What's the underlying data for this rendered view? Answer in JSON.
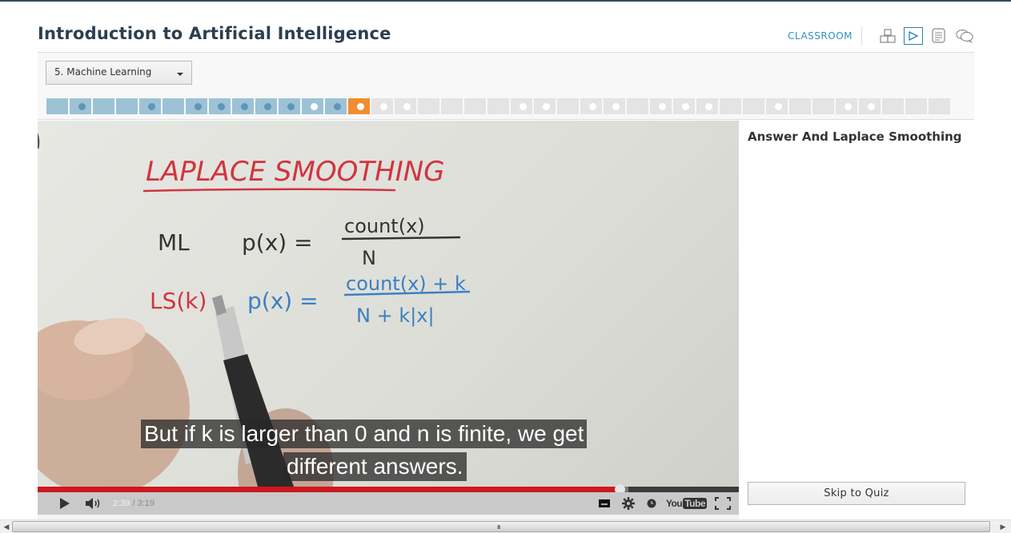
{
  "header": {
    "title": "Introduction to Artificial Intelligence",
    "classroom_link": "CLASSROOM",
    "nav_icons": [
      "course-map-icon",
      "video-icon",
      "notes-icon",
      "discussion-icon"
    ],
    "active_icon": "video-icon"
  },
  "lesson_selector": {
    "selected": "5. Machine Learning"
  },
  "progress": {
    "segments": [
      {
        "state": "done",
        "dot": "none"
      },
      {
        "state": "done",
        "dot": "blue"
      },
      {
        "state": "done",
        "dot": "none"
      },
      {
        "state": "done",
        "dot": "none"
      },
      {
        "state": "done",
        "dot": "blue"
      },
      {
        "state": "done",
        "dot": "none"
      },
      {
        "state": "done",
        "dot": "blue"
      },
      {
        "state": "done",
        "dot": "blue"
      },
      {
        "state": "done",
        "dot": "blue"
      },
      {
        "state": "done",
        "dot": "blue"
      },
      {
        "state": "done",
        "dot": "blue"
      },
      {
        "state": "done",
        "dot": "white"
      },
      {
        "state": "done",
        "dot": "blue"
      },
      {
        "state": "current",
        "dot": "white"
      },
      {
        "state": "todo",
        "dot": "white"
      },
      {
        "state": "todo",
        "dot": "white"
      },
      {
        "state": "todo",
        "dot": "none"
      },
      {
        "state": "todo",
        "dot": "none"
      },
      {
        "state": "todo",
        "dot": "none"
      },
      {
        "state": "todo",
        "dot": "none"
      },
      {
        "state": "todo",
        "dot": "white"
      },
      {
        "state": "todo",
        "dot": "white"
      },
      {
        "state": "todo",
        "dot": "none"
      },
      {
        "state": "todo",
        "dot": "white"
      },
      {
        "state": "todo",
        "dot": "white"
      },
      {
        "state": "todo",
        "dot": "none"
      },
      {
        "state": "todo",
        "dot": "white"
      },
      {
        "state": "todo",
        "dot": "white"
      },
      {
        "state": "todo",
        "dot": "white"
      },
      {
        "state": "todo",
        "dot": "none"
      },
      {
        "state": "todo",
        "dot": "none"
      },
      {
        "state": "todo",
        "dot": "white"
      },
      {
        "state": "todo",
        "dot": "none"
      },
      {
        "state": "todo",
        "dot": "none"
      },
      {
        "state": "todo",
        "dot": "white"
      },
      {
        "state": "todo",
        "dot": "white"
      },
      {
        "state": "todo",
        "dot": "none"
      },
      {
        "state": "todo",
        "dot": "none"
      },
      {
        "state": "todo",
        "dot": "none"
      }
    ],
    "colors": {
      "done": "#9dc2d6",
      "current": "#f28c30",
      "todo": "#e4e4e4"
    }
  },
  "video": {
    "whiteboard": {
      "title": "LAPLACE SMOOTHING",
      "row1_label": "ML",
      "row1_lhs": "p(x) =",
      "row1_num": "count(x)",
      "row1_den": "N",
      "row2_label": "LS(k)",
      "row2_lhs": "p(x) =",
      "row2_num": "count(x) + k",
      "row2_den": "N + k|x|"
    },
    "subtitles": [
      "But if k is larger than 0 and n is finite, we get",
      "different answers."
    ],
    "current_time": "2:39",
    "separator": " / ",
    "duration": "3:19",
    "played_fraction": 0.8295,
    "buffered_fraction": 0.8425,
    "controls": {
      "play": "play-icon",
      "volume": "volume-icon",
      "captions": "captions-icon",
      "settings": "gear-icon",
      "watch_later": "clock-icon",
      "logo": "youtube-logo",
      "fullscreen": "fullscreen-icon"
    },
    "logo_text_you": "You",
    "logo_text_tube": "Tube"
  },
  "sidebar": {
    "title": "Answer And Laplace Smoothing",
    "skip_button": "Skip to Quiz"
  },
  "scrollbar": {
    "grip": "III"
  }
}
